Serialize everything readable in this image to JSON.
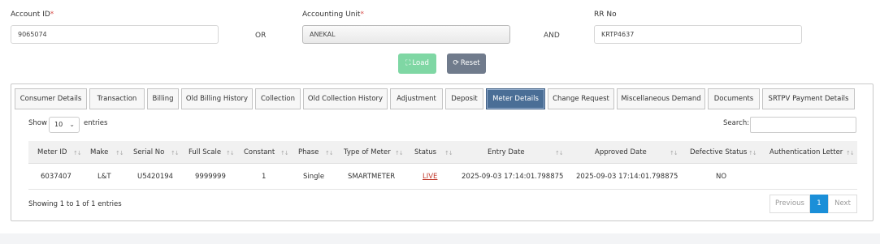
{
  "form": {
    "account_id_label": "Account ID",
    "account_id_value": "9065074",
    "accounting_unit_label": "Accounting Unit",
    "accounting_unit_value": "ANEKAL",
    "rr_no_label": "RR No",
    "rr_no_value": "KRTP4637",
    "required_mark": "*",
    "or_text": "OR",
    "and_text": "AND",
    "load_label": "Load",
    "reset_label": "Reset",
    "colors": {
      "load": "#7fd7a4",
      "reset": "#707b8c",
      "required": "#d9534f"
    }
  },
  "tabs": [
    {
      "label": "Consumer Details"
    },
    {
      "label": "Transaction"
    },
    {
      "label": "Billing"
    },
    {
      "label": "Old Billing History"
    },
    {
      "label": "Collection"
    },
    {
      "label": "Old Collection History"
    },
    {
      "label": "Adjustment"
    },
    {
      "label": "Deposit"
    },
    {
      "label": "Meter Details",
      "active": true
    },
    {
      "label": "Change Request"
    },
    {
      "label": "Miscellaneous Demand"
    },
    {
      "label": "Documents"
    },
    {
      "label": "SRTPV Payment Details"
    }
  ],
  "table_controls": {
    "show_label": "Show",
    "page_size": "10",
    "entries_label": "entries",
    "search_label": "Search:",
    "search_value": ""
  },
  "table": {
    "columns": [
      "Meter ID",
      "Make",
      "Serial No",
      "Full Scale",
      "Constant",
      "Phase",
      "Type of Meter",
      "Status",
      "Entry Date",
      "Approved Date",
      "Defective Status",
      "Authentication Letter"
    ],
    "rows": [
      [
        "6037407",
        "L&T",
        "U5420194",
        "9999999",
        "1",
        "Single",
        "SMARTMETER",
        "LIVE",
        "2025-09-03 17:14:01.798875",
        "2025-09-03 17:14:01.798875",
        "NO",
        ""
      ]
    ],
    "status_color": "#c0392b"
  },
  "footer": {
    "info": "Showing 1 to 1 of 1 entries",
    "previous": "Previous",
    "page": "1",
    "next": "Next",
    "active_color": "#1b8fd8"
  }
}
